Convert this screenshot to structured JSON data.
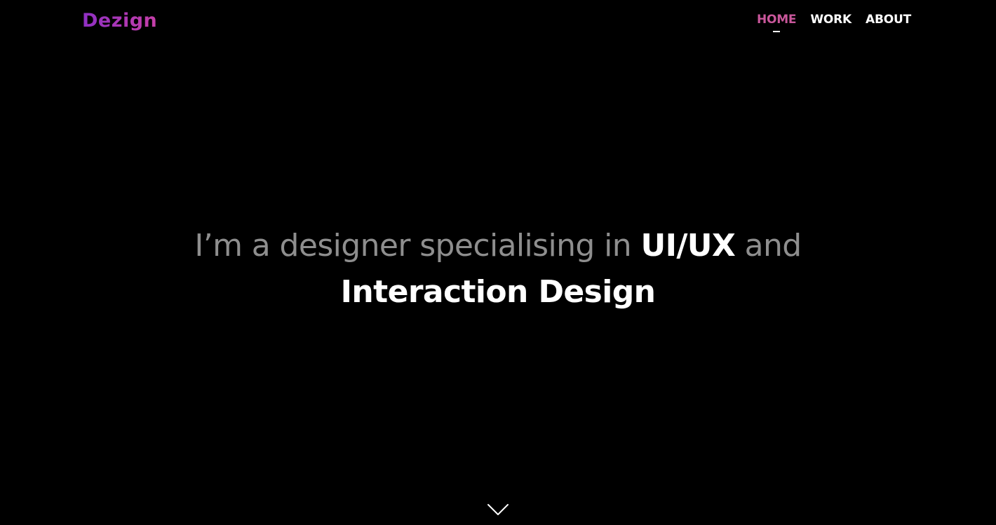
{
  "brand": {
    "logo_text": "Dezign",
    "accent_color": "#c9579b",
    "gradient_start": "#8f2fc4",
    "gradient_end": "#c53fa8"
  },
  "nav": {
    "items": [
      {
        "label": "HOME",
        "active": true
      },
      {
        "label": "WORK",
        "active": false
      },
      {
        "label": "ABOUT",
        "active": false
      }
    ]
  },
  "hero": {
    "line1_prefix": "I’m a designer specialising in ",
    "line1_emphasis": "UI/UX",
    "line1_suffix": " and",
    "line2_emphasis": "Interaction Design"
  },
  "scroll": {
    "icon": "chevron-down-icon"
  },
  "colors": {
    "background": "#000000",
    "muted_text": "#8e8e8e",
    "strong_text": "#ffffff"
  }
}
